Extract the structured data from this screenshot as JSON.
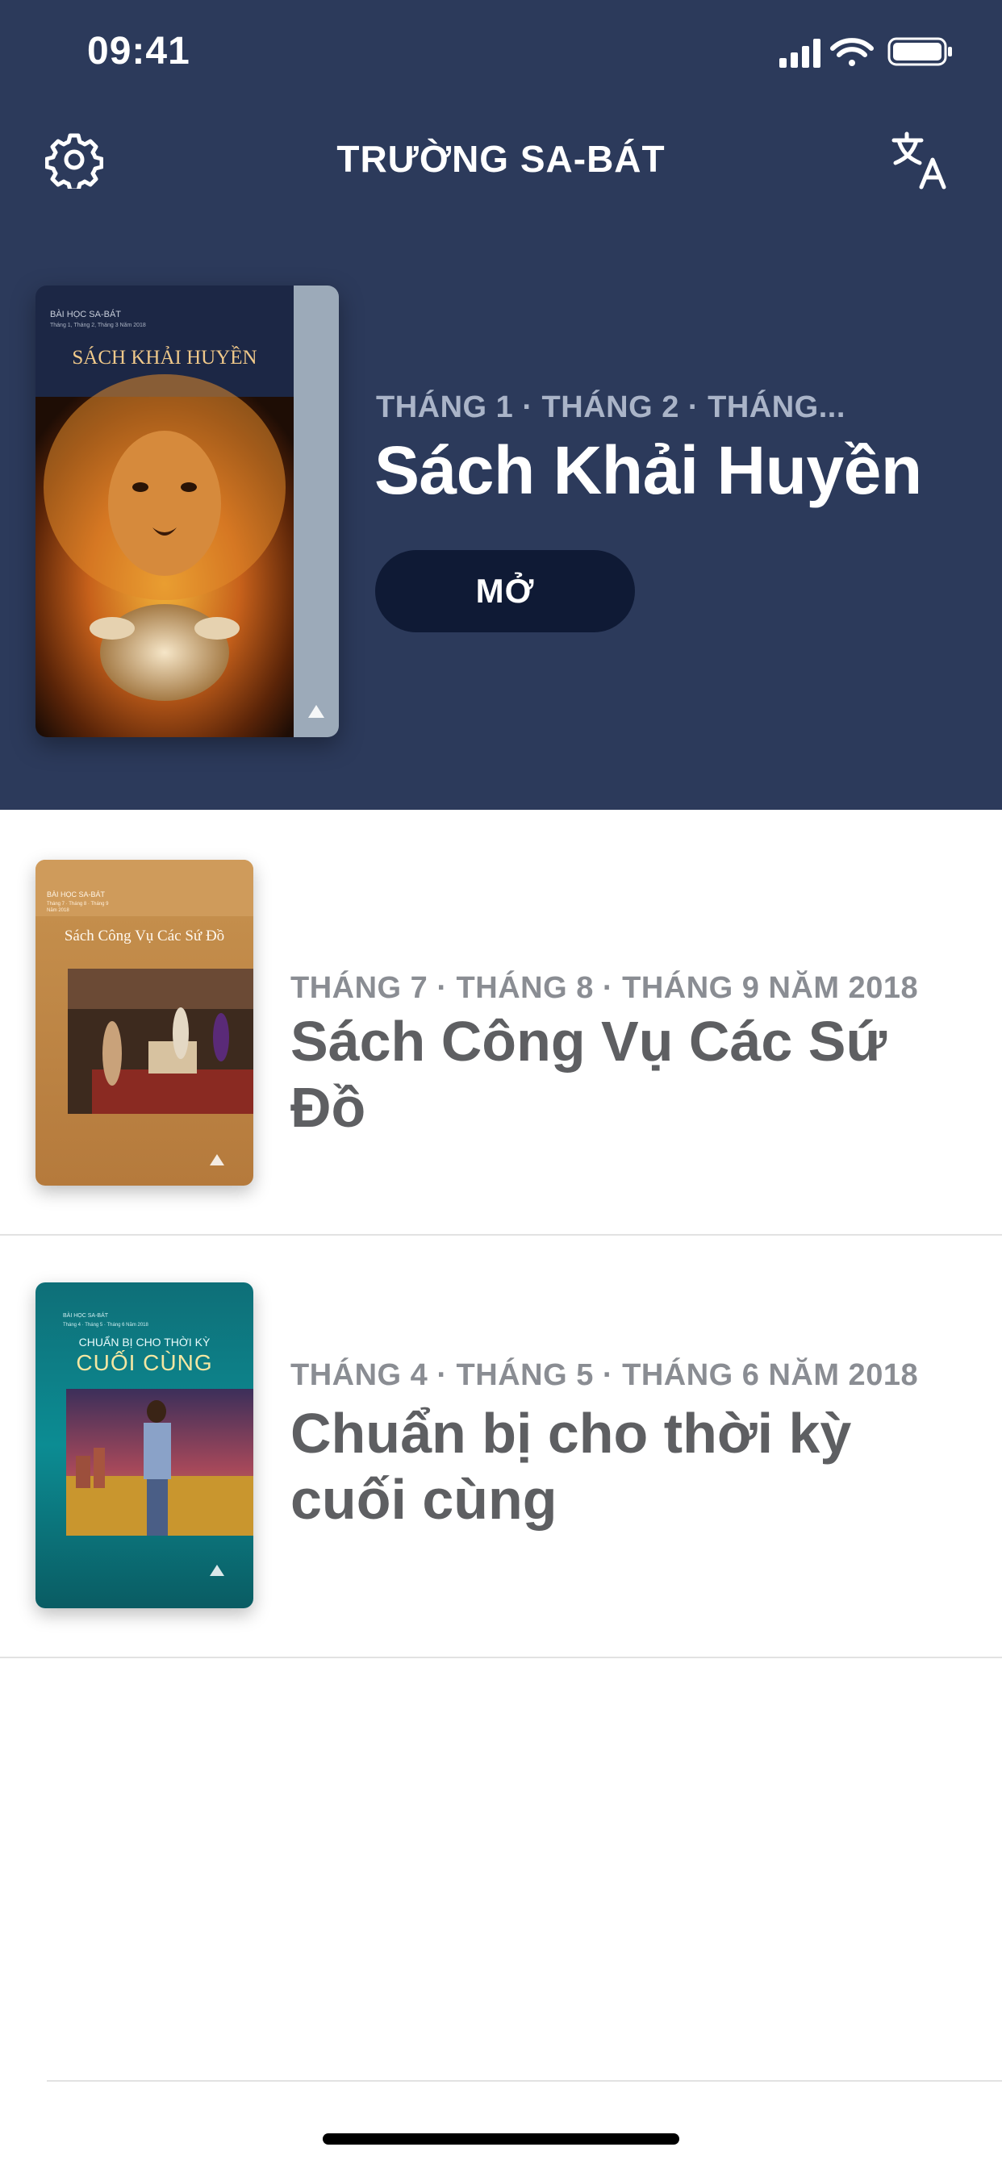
{
  "status_bar": {
    "time": "09:41"
  },
  "header": {
    "title": "TRƯỜNG SA-BÁT",
    "settings_icon": "gear-icon",
    "language_icon": "translate-icon"
  },
  "featured": {
    "cover": {
      "top_label": "BÀI HỌC SA-BÁT",
      "sub_label": "Tháng 1, Tháng 2, Tháng 3 Năm 2018",
      "title": "SÁCH KHẢI HUYỀN"
    },
    "meta": "THÁNG 1 · THÁNG 2 · THÁNG...",
    "title": "Sách Khải Huyền",
    "open_label": "MỞ"
  },
  "quarterlies": [
    {
      "cover": {
        "top_label": "BÀI HỌC SA-BÁT",
        "sub_label": "Tháng 7 · Tháng 8 · Tháng 9",
        "sub_label_2": "Năm 2018",
        "title": "Sách Công Vụ Các Sứ Đồ"
      },
      "meta": "THÁNG 7 · THÁNG 8 · THÁNG 9 NĂM 2018",
      "title": "Sách Công Vụ Các Sứ Đồ"
    },
    {
      "cover": {
        "top_label": "BÀI HỌC SA-BÁT",
        "sub_label": "Tháng 4 · Tháng 5 · Tháng 6 Năm 2018",
        "title_line1": "CHUẨN BỊ CHO THỜI KỲ",
        "title_line2": "CUỐI CÙNG"
      },
      "meta": "THÁNG 4 · THÁNG 5 · THÁNG 6 NĂM 2018",
      "title": "Chuẩn bị cho thời kỳ cuối cùng"
    }
  ],
  "colors": {
    "header_bg": "#2c3a5b",
    "button_bg": "#0f1a35",
    "meta_text": "#8a8d93",
    "title_text": "#5e5f62"
  }
}
